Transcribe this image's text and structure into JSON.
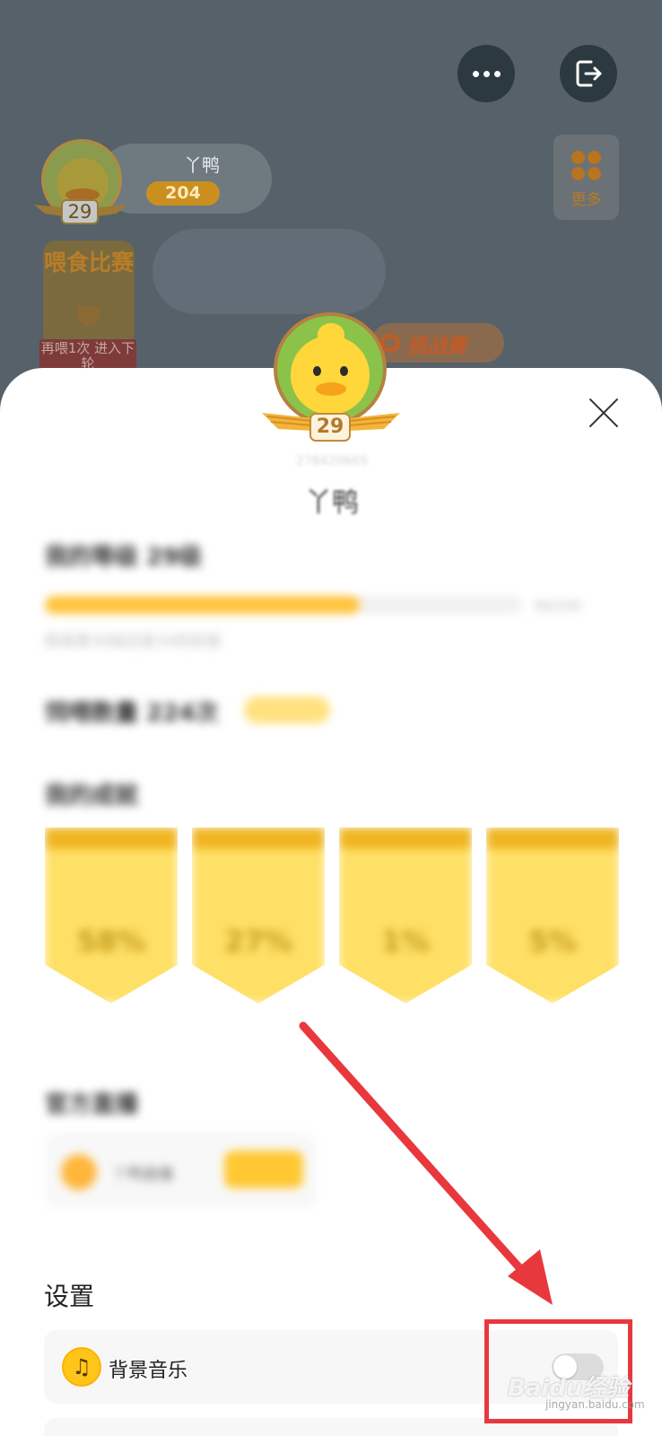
{
  "top_actions": {
    "menu_icon": "ellipsis-icon",
    "exit_icon": "exit-icon"
  },
  "profile": {
    "name": "丫鸭",
    "score": "204",
    "level": "29"
  },
  "more": {
    "label": "更多"
  },
  "contest": {
    "title": "喂食比赛",
    "ribbon": "再喂1次 进入下轮"
  },
  "challenge": {
    "label": "挑战赛"
  },
  "sheet": {
    "level": "29",
    "user_id": "278420665",
    "name": "丫鸭",
    "level_section_title": "我的等级 29级",
    "level_progress": 0.66,
    "level_progress_meta": "66/100",
    "level_hint": "距离第30级还差34经验值",
    "feed_section_title": "饲喂数量 224次",
    "medals_title": "我的成就",
    "medals": [
      "58%",
      "27%",
      "1%",
      "5%"
    ],
    "official_title": "官方直播",
    "official_card_text": "丫鸭直播",
    "settings_title": "设置",
    "bg_music_label": "背景音乐",
    "bg_music_icon": "music-note-icon",
    "bg_music_on": false
  },
  "annotation": {
    "arrow_color": "#e8383d",
    "watermark": "Baidu经验",
    "watermark_sub": "jingyan.baidu.com"
  }
}
